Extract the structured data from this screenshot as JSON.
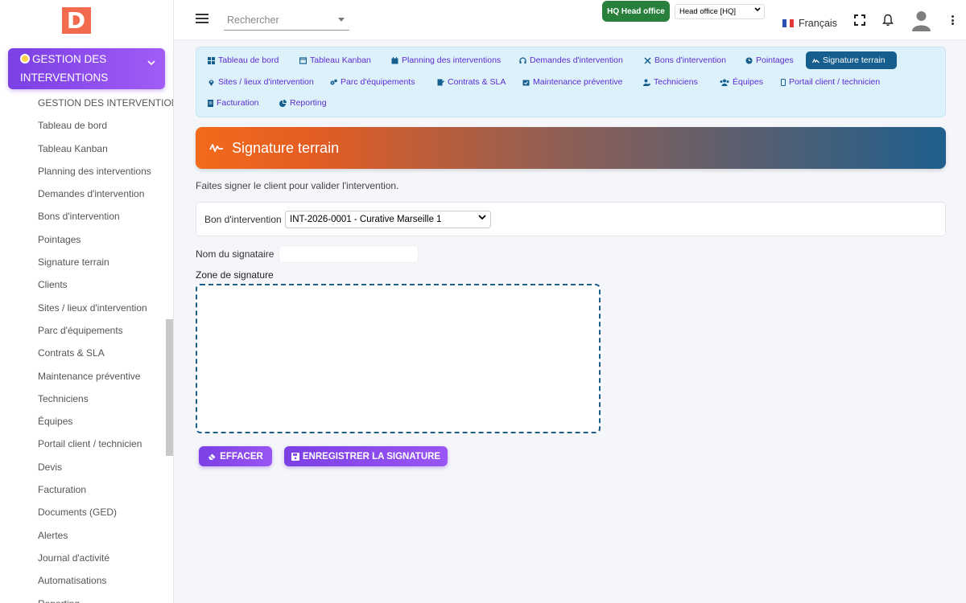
{
  "sidebar": {
    "logo_letter": "D",
    "module_title_line1": "GESTION DES",
    "module_title_line2": "INTERVENTIONS",
    "items": [
      {
        "label": "GESTION DES INTERVENTIONS"
      },
      {
        "label": "Tableau de bord"
      },
      {
        "label": "Tableau Kanban"
      },
      {
        "label": "Planning des interventions"
      },
      {
        "label": "Demandes d'intervention"
      },
      {
        "label": "Bons d'intervention"
      },
      {
        "label": "Pointages"
      },
      {
        "label": "Signature terrain"
      },
      {
        "label": "Clients"
      },
      {
        "label": "Sites / lieux d'intervention"
      },
      {
        "label": "Parc d'équipements"
      },
      {
        "label": "Contrats & SLA"
      },
      {
        "label": "Maintenance préventive"
      },
      {
        "label": "Techniciens"
      },
      {
        "label": "Équipes"
      },
      {
        "label": "Portail client / technicien"
      },
      {
        "label": "Devis"
      },
      {
        "label": "Facturation"
      },
      {
        "label": "Documents (GED)"
      },
      {
        "label": "Alertes"
      },
      {
        "label": "Journal d'activité"
      },
      {
        "label": "Automatisations"
      },
      {
        "label": "Reporting"
      }
    ]
  },
  "topbar": {
    "search_placeholder": "Rechercher",
    "hq_badge": "HQ Head office",
    "hq_select_value": "Head office [HQ]",
    "language": "Français"
  },
  "tabs": [
    {
      "label": "Tableau de bord",
      "icon": "dashboard-icon"
    },
    {
      "label": "Tableau Kanban",
      "icon": "kanban-icon"
    },
    {
      "label": "Planning des interventions",
      "icon": "calendar-icon"
    },
    {
      "label": "Demandes d'intervention",
      "icon": "headset-icon"
    },
    {
      "label": "Bons d'intervention",
      "icon": "tools-icon"
    },
    {
      "label": "Pointages",
      "icon": "clock-icon"
    },
    {
      "label": "Signature terrain",
      "icon": "signature-icon",
      "active": true
    },
    {
      "label": "Sites / lieux d'intervention",
      "icon": "map-pin-icon"
    },
    {
      "label": "Parc d'équipements",
      "icon": "cogs-icon"
    },
    {
      "label": "Contrats & SLA",
      "icon": "contract-icon"
    },
    {
      "label": "Maintenance préventive",
      "icon": "calendar-check-icon"
    },
    {
      "label": "Techniciens",
      "icon": "user-cog-icon"
    },
    {
      "label": "Équipes",
      "icon": "users-icon"
    },
    {
      "label": "Portail client / technicien",
      "icon": "mobile-icon"
    },
    {
      "label": "Facturation",
      "icon": "invoice-icon"
    },
    {
      "label": "Reporting",
      "icon": "pie-chart-icon"
    }
  ],
  "page": {
    "title": "Signature terrain",
    "subtitle": "Faites signer le client pour valider l'intervention.",
    "bon_label": "Bon d'intervention",
    "bon_value": "INT-2026-0001 - Curative Marseille 1",
    "nom_label": "Nom du signataire",
    "nom_value": "",
    "zone_label": "Zone de signature",
    "clear_button": "EFFACER",
    "save_button": "ENREGISTRER LA SIGNATURE"
  },
  "colors": {
    "accent_purple": "#7b3fe4",
    "active_tab": "#155e8d",
    "hq_green": "#28803c",
    "banner_start": "#f26a1b",
    "banner_end": "#1f5f8d"
  }
}
